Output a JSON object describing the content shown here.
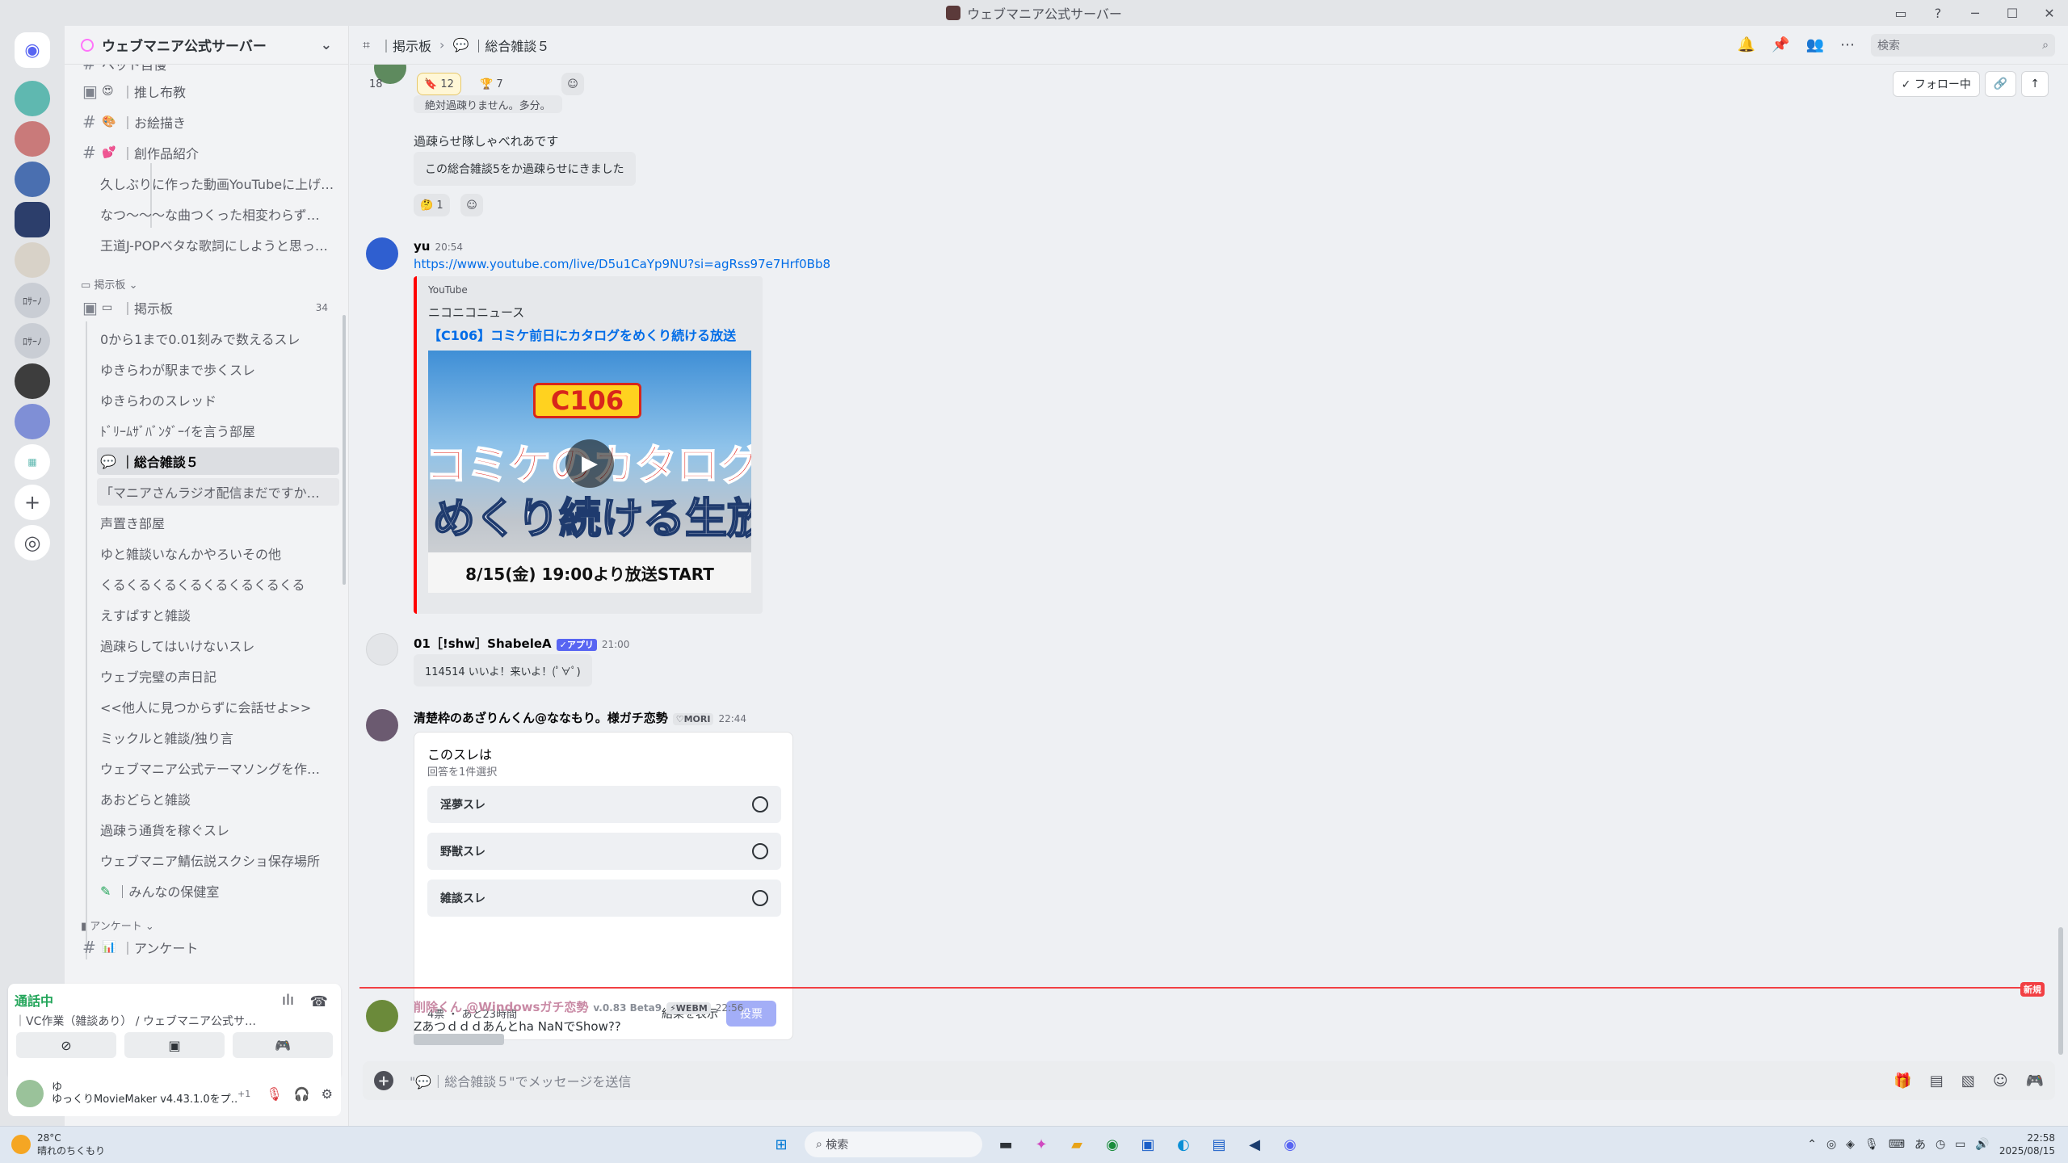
{
  "window": {
    "title": "ウェブマニア公式サーバー",
    "controls": [
      "─",
      "☐",
      "✕"
    ]
  },
  "colors": {
    "accent": "#5865f2",
    "link": "#006ce7",
    "new_red": "#f23f43",
    "online": "#23a55a"
  },
  "server": {
    "name": "ウェブマニア公式サーバー"
  },
  "servers": [
    "ﾛｻｰﾉ",
    "ﾛｻｰﾉ"
  ],
  "channels": {
    "top_partial": "ペット自慢",
    "items": [
      {
        "label": "｜推し布教"
      },
      {
        "label": "｜お絵描き"
      },
      {
        "label": "｜創作品紹介"
      }
    ],
    "threads_top": [
      "久しぶりに作った動画YouTubeに上げ…",
      "なつ～～～な曲つくった相変わらず…",
      "王道J-POPベタな歌詞にしようと思っ…"
    ],
    "forum_category": "掲示板",
    "forum_channel": {
      "label": "｜掲示板",
      "count": "34"
    },
    "forum_threads": [
      "0から1まで0.01刻みで数えるスレ",
      "ゆきらわが駅まで歩くスレ",
      "ゆきらわのスレッド",
      "ﾄﾞﾘｰﾑｻﾞﾊﾞﾝﾀﾞｰｲを言う部屋",
      "｜総合雑談５",
      "「マニアさんラジオ配信まだですか…",
      "声置き部屋",
      "ゆと雑談いなんかやろいその他",
      "くるくるくるくるくるくるくるくる",
      "えすぱすと雑談",
      "過疎らしてはいけないスレ",
      "ウェブ完璧の声日記",
      "<<他人に見つからずに会話せよ>>",
      "ミックルと雑談/独り言",
      "ウェブマニア公式テーマソングを作…",
      "あおどらと雑談",
      "過疎う通貨を稼ぐスレ",
      "ウェブマニア鯖伝説スクショ保存場所",
      "｜みんなの保健室"
    ],
    "survey_category": "アンケート",
    "survey_channel": "｜アンケート"
  },
  "voice": {
    "status": "通話中",
    "channel": "｜VC作業（雑談あり） / ウェブマニア公式サ…"
  },
  "user": {
    "name": "ゆ",
    "activity": "ゆっくりMovieMaker v4.43.1.0をプ…",
    "plus": "+1"
  },
  "header": {
    "forum": "｜掲示板",
    "thread": "｜総合雑談５",
    "search_placeholder": "検索",
    "follow": "✓ フォロー中"
  },
  "messages": {
    "top_reactions": {
      "a": "18",
      "b": "12",
      "c": "7"
    },
    "partial_line": "絶対過疎りません。多分。",
    "m1_line1": "過疎らせ隊しゃべれあです",
    "m1_line2": "この総合雑談5をか過疎らせにきました",
    "m1_reaction": "1",
    "m2": {
      "author": "yu",
      "time": "20:54",
      "url": "https://www.youtube.com/live/D5u1CaYp9NU?si=agRss97e7Hrf0Bb8",
      "embed_provider": "YouTube",
      "embed_author": "ニコニコニュース",
      "embed_title": "【C106】コミケ前日にカタログをめくり続ける放送",
      "thumb_badge": "C106",
      "thumb_line1": "コミケのカタログを",
      "thumb_line2": "めくり続ける生放送",
      "thumb_date": "8/15(金) 19:00より放送START"
    },
    "m3": {
      "author": "01［!shw］ShabeleA",
      "tag": "✓アプリ",
      "time": "21:00",
      "text": "114514 いいよ！来いよ！(ﾟ∀ﾟ)"
    },
    "m4": {
      "author": "清楚枠のあざりんくん@ななもり。様ガチ恋勢",
      "role": "♡MORI",
      "time": "22:44"
    },
    "poll": {
      "question": "このスレは",
      "subtitle": "回答を1件選択",
      "options": [
        "淫夢スレ",
        "野獣スレ",
        "雑談スレ"
      ],
      "footer": "4票 ・ あと23時間",
      "show_results": "結果を表示",
      "vote": "投票"
    },
    "new_label": "新規",
    "m5": {
      "author": "削除くん @Windowsガチ恋勢",
      "version": "v.0.83 Beta9",
      "tag": "⚡WEBM",
      "time": "22:56",
      "text": "Zあつｄｄｄあんとha NaNでShow??"
    }
  },
  "input": {
    "placeholder": "\"💬｜総合雑談５\"でメッセージを送信"
  },
  "taskbar": {
    "temp": "28°C",
    "weather": "晴れのちくもり",
    "search": "検索",
    "time": "22:58",
    "date": "2025/08/15",
    "ime": "あ"
  }
}
